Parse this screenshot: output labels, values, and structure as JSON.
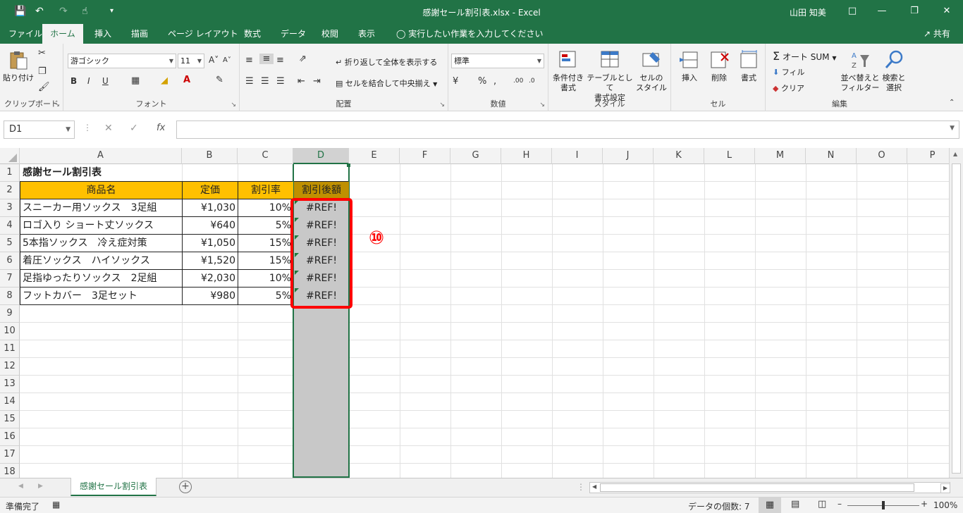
{
  "window": {
    "title": "感謝セール割引表.xlsx  -  Excel",
    "user": "山田 知美"
  },
  "tabs": [
    "ファイル",
    "ホーム",
    "挿入",
    "描画",
    "ページ レイアウト",
    "数式",
    "データ",
    "校閲",
    "表示"
  ],
  "active_tab": "ホーム",
  "tell_me": "実行したい作業を入力してください",
  "share": "共有",
  "ribbon": {
    "clipboard": {
      "label": "クリップボード",
      "paste": "貼り付け"
    },
    "font": {
      "label": "フォント",
      "name": "游ゴシック",
      "size": "11",
      "bold": "B",
      "italic": "I",
      "underline": "U"
    },
    "alignment": {
      "label": "配置",
      "wrap": "折り返して全体を表示する",
      "merge": "セルを結合して中央揃え"
    },
    "number": {
      "label": "数値",
      "format": "標準"
    },
    "styles": {
      "label": "スタイル",
      "conditional": [
        "条件付き",
        "書式"
      ],
      "table": [
        "テーブルとして",
        "書式設定"
      ],
      "cell": [
        "セルの",
        "スタイル"
      ]
    },
    "cells": {
      "label": "セル",
      "insert": "挿入",
      "delete": "削除",
      "format": "書式"
    },
    "editing": {
      "label": "編集",
      "autosum": "オート SUM",
      "fill": "フィル",
      "clear": "クリア",
      "sort": [
        "並べ替えと",
        "フィルター"
      ],
      "find": [
        "検索と",
        "選択"
      ]
    }
  },
  "namebox": "D1",
  "fx": "fx",
  "columns": [
    "A",
    "B",
    "C",
    "D",
    "E",
    "F",
    "G",
    "H",
    "I",
    "J",
    "K",
    "L",
    "M",
    "N",
    "O",
    "P"
  ],
  "rows": [
    "1",
    "2",
    "3",
    "4",
    "5",
    "6",
    "7",
    "8",
    "9",
    "10",
    "11",
    "12",
    "13",
    "14",
    "15",
    "16",
    "17",
    "18"
  ],
  "sheet": {
    "title": "感謝セール割引表",
    "headers": [
      "商品名",
      "定価",
      "割引率",
      "割引後額"
    ],
    "data": [
      [
        "スニーカー用ソックス　3足組",
        "¥1,030",
        "10%",
        "#REF!"
      ],
      [
        "ロゴ入り ショート丈ソックス",
        "¥640",
        "5%",
        "#REF!"
      ],
      [
        "5本指ソックス　冷え症対策",
        "¥1,050",
        "15%",
        "#REF!"
      ],
      [
        "着圧ソックス　ハイソックス",
        "¥1,520",
        "15%",
        "#REF!"
      ],
      [
        "足指ゆったりソックス　2足組",
        "¥2,030",
        "10%",
        "#REF!"
      ],
      [
        "フットカバー　3足セット",
        "¥980",
        "5%",
        "#REF!"
      ]
    ]
  },
  "annotation": "⑩",
  "sheet_tab": "感謝セール割引表",
  "status": {
    "ready": "準備完了",
    "count": "データの個数: 7",
    "zoom": "100%"
  },
  "colors": {
    "excel_green": "#217346",
    "header_fill": "#ffc000",
    "highlight": "#ff0000",
    "selection": "#c8c8c8"
  }
}
